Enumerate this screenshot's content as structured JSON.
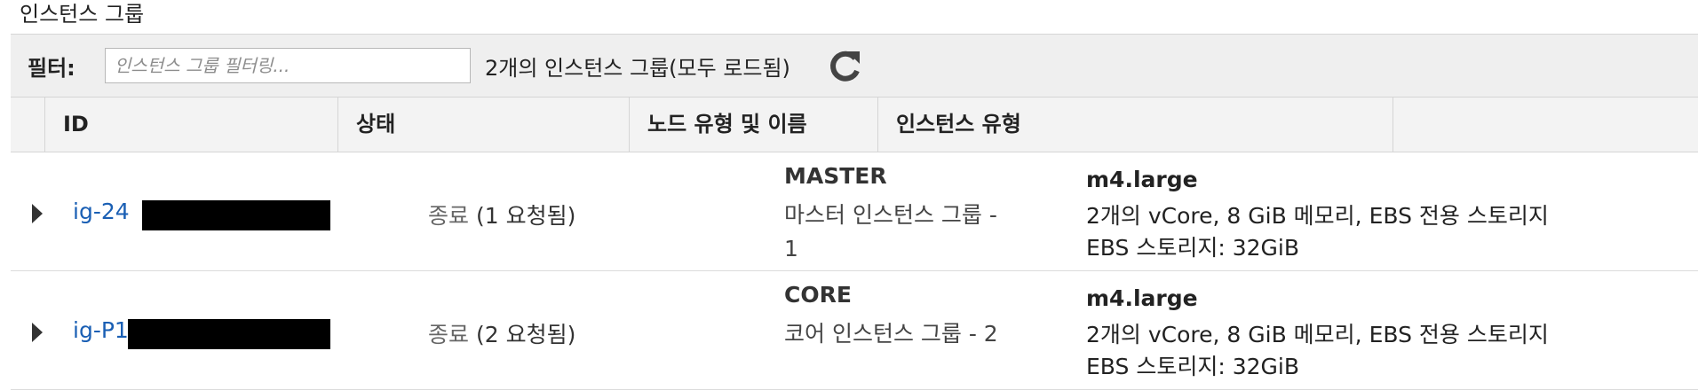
{
  "section": {
    "title": "인스턴스 그룹"
  },
  "toolbar": {
    "filter_label": "필터:",
    "filter_placeholder": "인스턴스 그룹 필터링...",
    "filter_value": "",
    "count_text": "2개의 인스턴스 그룹(모두 로드됨)",
    "refresh_icon": "refresh-icon"
  },
  "table": {
    "columns": [
      "ID",
      "상태",
      "노드 유형 및 이름",
      "인스턴스 유형"
    ],
    "rows": [
      {
        "id": "ig-24",
        "status_word": "종료",
        "status_detail": " (1 요청됨)",
        "node_type": "MASTER",
        "node_name": "마스터 인스턴스 그룹 - 1",
        "instance_type": "m4.large",
        "instance_spec": "2개의 vCore, 8 GiB 메모리, EBS 전용 스토리지",
        "ebs_storage": "EBS 스토리지:  32GiB"
      },
      {
        "id": "ig-P1",
        "status_word": "종료",
        "status_detail": " (2 요청됨)",
        "node_type": "CORE",
        "node_name": "코어 인스턴스 그룹 - 2",
        "instance_type": "m4.large",
        "instance_spec": "2개의 vCore, 8 GiB 메모리, EBS 전용 스토리지",
        "ebs_storage": "EBS 스토리지:  32GiB"
      }
    ]
  }
}
